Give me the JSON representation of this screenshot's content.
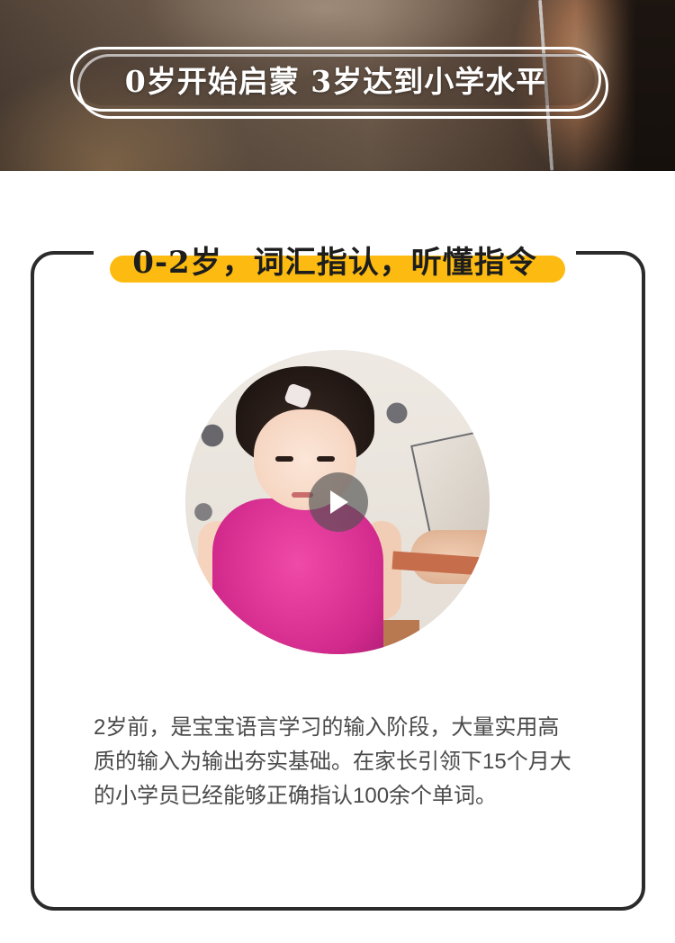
{
  "banner": {
    "title": "0岁开始启蒙 3岁达到小学水平"
  },
  "section": {
    "title": "0-2岁，词汇指认，听懂指令",
    "highlight_color": "#fdbb11",
    "video": {
      "play_icon": "play-icon"
    },
    "description": "2岁前，是宝宝语言学习的输入阶段，大量实用高质的输入为输出夯实基础。在家长引领下15个月大的小学员已经能够正确指认100余个单词。"
  }
}
